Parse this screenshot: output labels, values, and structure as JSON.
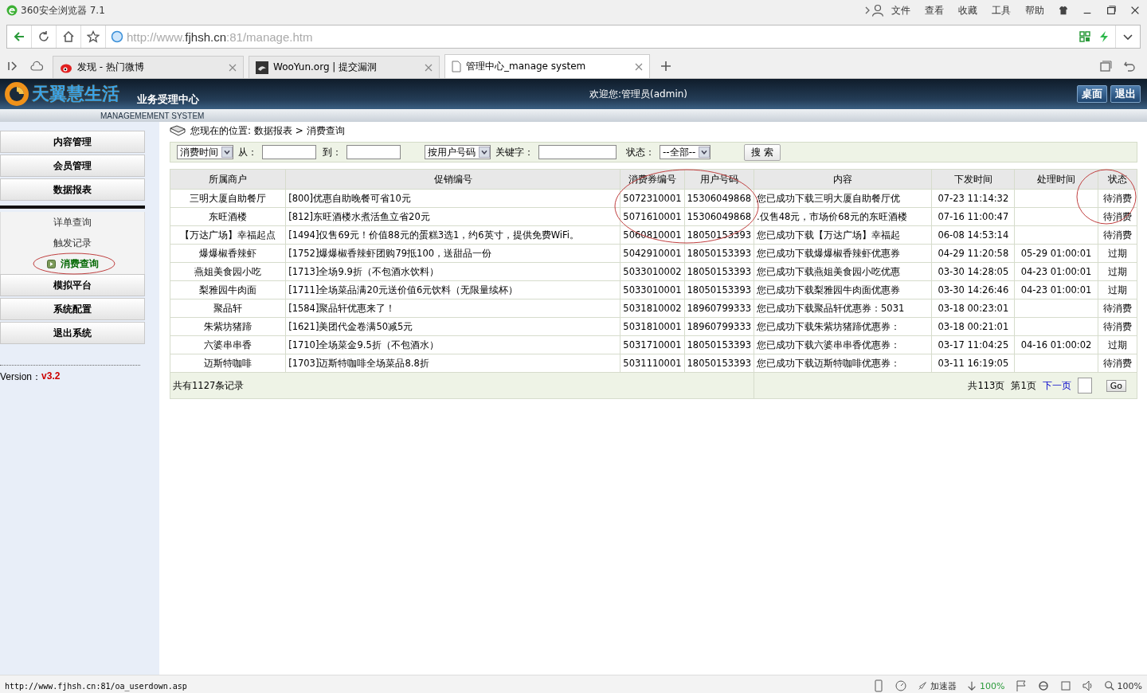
{
  "browser": {
    "title": "360安全浏览器 7.1",
    "menu": [
      "文件",
      "查看",
      "收藏",
      "工具",
      "帮助"
    ],
    "url": {
      "host": "http://www.",
      "domain": "fjhsh.cn",
      "rest": ":81/manage.htm"
    },
    "tabs": [
      {
        "label": "发现 - 热门微博",
        "selected": false
      },
      {
        "label": "WooYun.org | 提交漏洞",
        "selected": false
      },
      {
        "label": "管理中心_manage system",
        "selected": true
      }
    ],
    "status_url": "http://www.fjhsh.cn:81/oa_userdown.asp",
    "status_items": [
      "加速器",
      "100%",
      "100%"
    ]
  },
  "header": {
    "logo": "天翼慧生活",
    "subtitle": "业务受理中心",
    "system": "MANAGEMEMENT SYSTEM",
    "welcome": "欢迎您:管理员(admin)",
    "buttons": [
      "桌面",
      "退出"
    ]
  },
  "sidebar": {
    "items": [
      {
        "label": "内容管理",
        "kind": "section",
        "selected": false
      },
      {
        "label": "会员管理",
        "kind": "section",
        "selected": false
      },
      {
        "label": "数据报表",
        "kind": "section",
        "selected": false
      },
      {
        "label": "详单查询",
        "kind": "sub",
        "selected": false
      },
      {
        "label": "触发记录",
        "kind": "sub",
        "selected": false
      },
      {
        "label": "消费查询",
        "kind": "sub",
        "selected": true
      },
      {
        "label": "模拟平台",
        "kind": "section",
        "selected": false
      },
      {
        "label": "系统配置",
        "kind": "section",
        "selected": false
      },
      {
        "label": "退出系统",
        "kind": "section",
        "selected": false
      }
    ],
    "version_label": "Version：",
    "version": "v3.2"
  },
  "breadcrumb": "您现在的位置: 数据报表 > 消费查询",
  "filters": {
    "date_type": "消费时间",
    "from_label": "从：",
    "to_label": "到：",
    "search_by": "按用户号码",
    "keyword_label": "关键字：",
    "status_label": "状态：",
    "status": "--全部--",
    "button": "搜 索"
  },
  "table": {
    "columns": [
      "所属商户",
      "促销编号",
      "消费券编号",
      "用户号码",
      "内容",
      "下发时间",
      "处理时间",
      "状态"
    ],
    "rows": [
      [
        "三明大厦自助餐厅",
        "[800]优惠自助晚餐可省10元",
        "5072310001",
        "15306049868",
        "您已成功下载三明大厦自助餐厅优",
        "07-23 11:14:32",
        "",
        "待消费"
      ],
      [
        "东旺酒楼",
        "[812]东旺酒楼水煮活鱼立省20元",
        "5071610001",
        "15306049868",
        ".仅售48元，市场价68元的东旺酒楼",
        "07-16 11:00:47",
        "",
        "待消费"
      ],
      [
        "【万达广场】幸福起点",
        "[1494]仅售69元！价值88元的蛋糕3选1，约6英寸，提供免费WiFi。",
        "5060810001",
        "18050153393",
        "您已成功下载【万达广场】幸福起",
        "06-08 14:53:14",
        "",
        "待消费"
      ],
      [
        "爆爆椒香辣虾",
        "[1752]爆爆椒香辣虾团购79抵100，送甜品一份",
        "5042910001",
        "18050153393",
        "您已成功下载爆爆椒香辣虾优惠券",
        "04-29 11:20:58",
        "05-29 01:00:01",
        "过期"
      ],
      [
        "燕姐美食园小吃",
        "[1713]全场9.9折（不包酒水饮料）",
        "5033010002",
        "18050153393",
        "您已成功下载燕姐美食园小吃优惠",
        "03-30 14:28:05",
        "04-23 01:00:01",
        "过期"
      ],
      [
        "梨雅园牛肉面",
        "[1711]全场菜品满20元送价值6元饮料（无限量续杯）",
        "5033010001",
        "18050153393",
        "您已成功下载梨雅园牛肉面优惠券",
        "03-30 14:26:46",
        "04-23 01:00:01",
        "过期"
      ],
      [
        "聚品轩",
        "[1584]聚品轩优惠来了！",
        "5031810002",
        "18960799333",
        "您已成功下载聚品轩优惠券：5031",
        "03-18 00:23:01",
        "",
        "待消费"
      ],
      [
        "朱紫坊猪蹄",
        "[1621]美团代金卷满50减5元",
        "5031810001",
        "18960799333",
        "您已成功下载朱紫坊猪蹄优惠券：",
        "03-18 00:21:01",
        "",
        "待消费"
      ],
      [
        "六婆串串香",
        "[1710]全场菜金9.5折（不包酒水）",
        "5031710001",
        "18050153393",
        "您已成功下载六婆串串香优惠券：",
        "03-17 11:04:25",
        "04-16 01:00:02",
        "过期"
      ],
      [
        "迈斯特咖啡",
        "[1703]迈斯特咖啡全场菜品8.8折",
        "5031110001",
        "18050153393",
        "您已成功下载迈斯特咖啡优惠券：",
        "03-11 16:19:05",
        "",
        "待消费"
      ]
    ],
    "total": "共有1127条记录",
    "pages": "共113页",
    "current": "第1页",
    "next": "下一页",
    "go": "Go"
  }
}
